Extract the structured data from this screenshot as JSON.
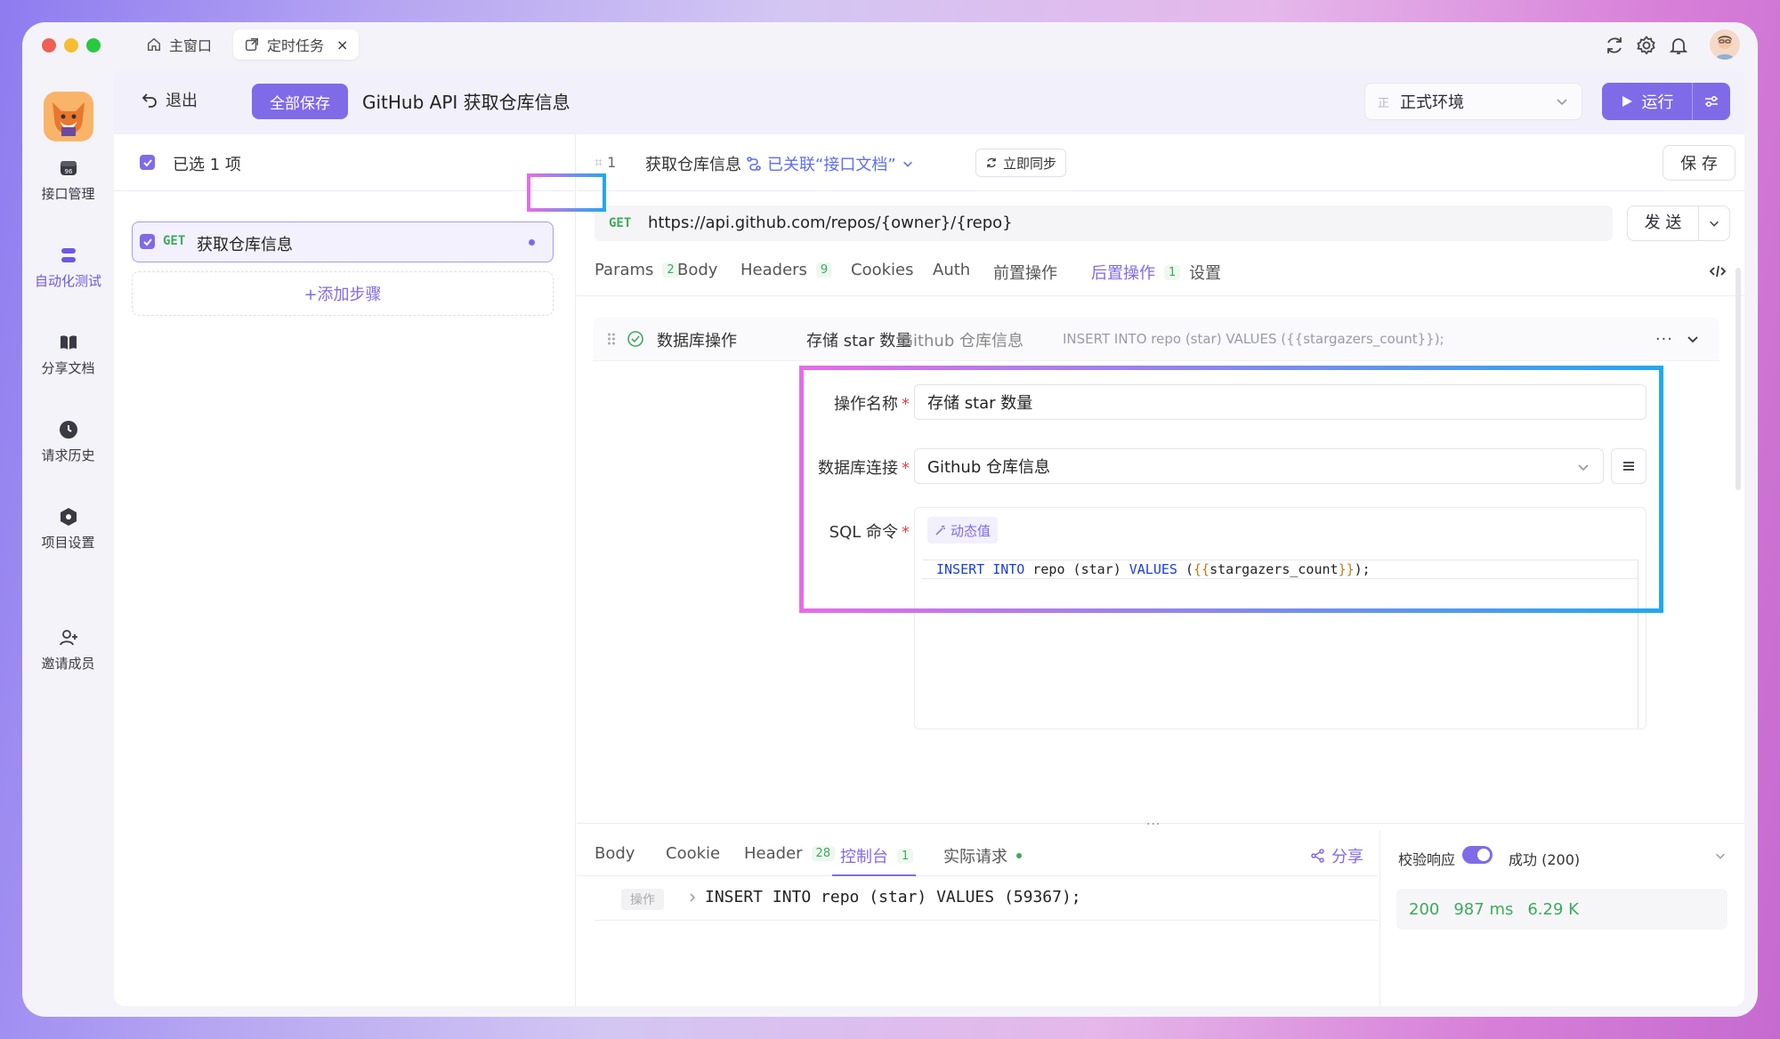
{
  "titlebar": {
    "tabs": [
      {
        "label": "主窗口",
        "icon": "home-icon"
      },
      {
        "label": "定时任务",
        "icon": "external-window-icon",
        "close": "×"
      }
    ]
  },
  "sidebar": {
    "items": [
      {
        "label": "接口管理",
        "icon": "api-icon"
      },
      {
        "label": "自动化测试",
        "icon": "automation-icon"
      },
      {
        "label": "分享文档",
        "icon": "book-icon"
      },
      {
        "label": "请求历史",
        "icon": "clock-icon"
      },
      {
        "label": "项目设置",
        "icon": "settings-hex-icon"
      },
      {
        "label": "邀请成员",
        "icon": "user-add-icon"
      }
    ]
  },
  "header": {
    "exit_label": "退出",
    "save_all_label": "全部保存",
    "title": "GitHub API 获取仓库信息",
    "env_badge": "正",
    "env_label": "正式环境",
    "run_label": "运行"
  },
  "left": {
    "selected_label": "已选 1 项",
    "steps": [
      {
        "method": "GET",
        "name": "获取仓库信息"
      }
    ],
    "add_step_label": "+添加步骤"
  },
  "step": {
    "number": "1",
    "name": "获取仓库信息",
    "linked_label": "已关联“接口文档”",
    "sync_label": "立即同步",
    "save_label": "保 存",
    "method": "GET",
    "url": "https://api.github.com/repos/{owner}/{repo}",
    "send_label": "发 送"
  },
  "tabs": [
    {
      "label": "Params",
      "count": "2"
    },
    {
      "label": "Body"
    },
    {
      "label": "Headers",
      "count": "9"
    },
    {
      "label": "Cookies"
    },
    {
      "label": "Auth"
    },
    {
      "label": "前置操作"
    },
    {
      "label": "后置操作",
      "count": "1",
      "active": true
    },
    {
      "label": "设置"
    }
  ],
  "db_op": {
    "title": "数据库操作",
    "name_summary": "存储 star 数量",
    "conn_summary": "Github 仓库信息",
    "sql_summary": "INSERT INTO repo (star) VALUES ({{stargazers_count}});",
    "more": "···",
    "form": {
      "name_label": "操作名称",
      "name_value": "存储 star 数量",
      "conn_label": "数据库连接",
      "conn_value": "Github 仓库信息",
      "sql_label": "SQL 命令",
      "dynamic_label": "动态值",
      "required": "*",
      "code": {
        "k1": "INSERT",
        "k2": "INTO",
        "t1": "repo",
        "p1": "(",
        "t2": "star",
        "p2": ")",
        "k3": "VALUES",
        "p3": "(",
        "b1": "{{",
        "t3": "stargazers_count",
        "b2": "}}",
        "p4": ")",
        "semi": ";"
      }
    }
  },
  "bottom": {
    "tabs": [
      {
        "label": "Body"
      },
      {
        "label": "Cookie"
      },
      {
        "label": "Header",
        "count": "28"
      },
      {
        "label": "控制台",
        "count": "1",
        "active": true
      },
      {
        "label": "实际请求"
      }
    ],
    "share_label": "分享",
    "log_tag": "操作",
    "log_text": "INSERT INTO repo (star) VALUES (59367);",
    "validate_label": "校验响应",
    "status_label": "成功 (200)",
    "status_code": "200",
    "time": "987 ms",
    "size": "6.29 K"
  },
  "colors": {
    "accent": "#7f6be8",
    "success": "#3eaa5a",
    "link": "#5b6ff0"
  }
}
